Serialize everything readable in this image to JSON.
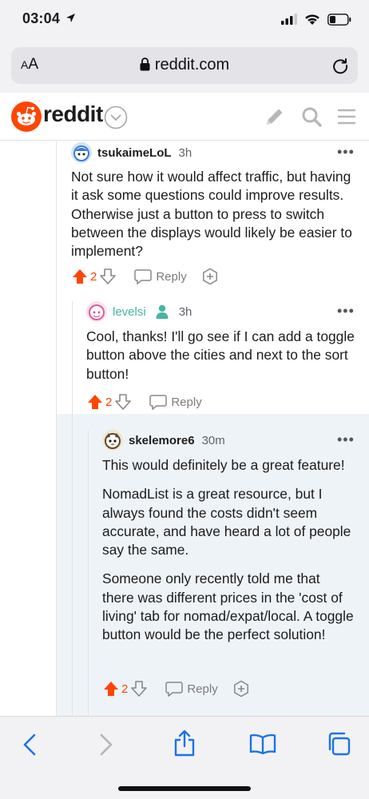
{
  "status_bar": {
    "time": "03:04"
  },
  "browser": {
    "aa_label_small": "A",
    "aa_label_big": "A",
    "url": "reddit.com"
  },
  "reddit": {
    "brand": "reddit"
  },
  "comments": [
    {
      "username": "tsukaimeLoL",
      "time": "3h",
      "body": [
        "Not sure how it would affect traffic, but having it ask some questions could improve results. Otherwise just a button to press to switch between the displays would likely be easier to implement?"
      ],
      "votes": "2",
      "reply_label": "Reply"
    },
    {
      "username": "levelsi",
      "time": "3h",
      "body": [
        "Cool, thanks! I'll go see if I can add a toggle button above the cities and next to the sort button!"
      ],
      "votes": "2",
      "reply_label": "Reply"
    },
    {
      "username": "skelemore6",
      "time": "30m",
      "body": [
        "This would definitely be a great feature!",
        "NomadList is a great resource, but I always found the costs didn't seem accurate, and have heard a lot of people say the same.",
        "Someone only recently told me that there was different prices in the 'cost of living' tab for nomad/expat/local. A toggle button would be the perfect solution!"
      ],
      "votes": "2",
      "reply_label": "Reply"
    }
  ],
  "colors": {
    "upvote": "#ff4500",
    "mod_green": "#46b5a3",
    "safari_blue": "#1a73e8",
    "nested_highlight": "#eef3f8"
  },
  "icons": [
    "location-arrow-icon",
    "signal-icon",
    "wifi-icon",
    "battery-icon",
    "lock-icon",
    "reload-icon",
    "reddit-snoo-icon",
    "chevron-down-icon",
    "pencil-icon",
    "search-icon",
    "hamburger-icon",
    "more-icon",
    "upvote-icon",
    "downvote-icon",
    "reply-icon",
    "award-icon",
    "mod-shield-icon",
    "back-icon",
    "forward-icon",
    "share-icon",
    "bookmarks-icon",
    "tabs-icon"
  ]
}
